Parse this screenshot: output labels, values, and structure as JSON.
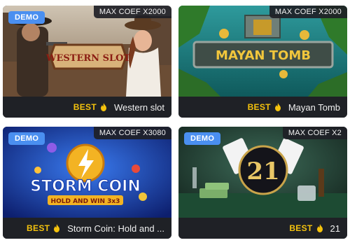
{
  "cards": [
    {
      "title": "Western slot",
      "best_label": "BEST",
      "coef_label": "MAX COEF X2000",
      "demo_label": "DEMO",
      "art_text": "WESTERN SLOT"
    },
    {
      "title": "Mayan Tomb",
      "best_label": "BEST",
      "coef_label": "MAX COEF X2000",
      "demo_label": "",
      "art_text": "MAYAN TOMB"
    },
    {
      "title": "Storm Coin: Hold and ...",
      "best_label": "BEST",
      "coef_label": "MAX COEF X3080",
      "demo_label": "DEMO",
      "art_text": "STORM COIN",
      "art_subtext": "HOLD AND WIN 3x3"
    },
    {
      "title": "21",
      "best_label": "BEST",
      "coef_label": "MAX COEF X2",
      "demo_label": "DEMO",
      "art_text": "21"
    }
  ],
  "icons": {
    "best": "flame-icon"
  },
  "colors": {
    "demo_badge": "#4a8ff0",
    "best_text": "#f4c20d",
    "card_bar": "#1f2126"
  }
}
